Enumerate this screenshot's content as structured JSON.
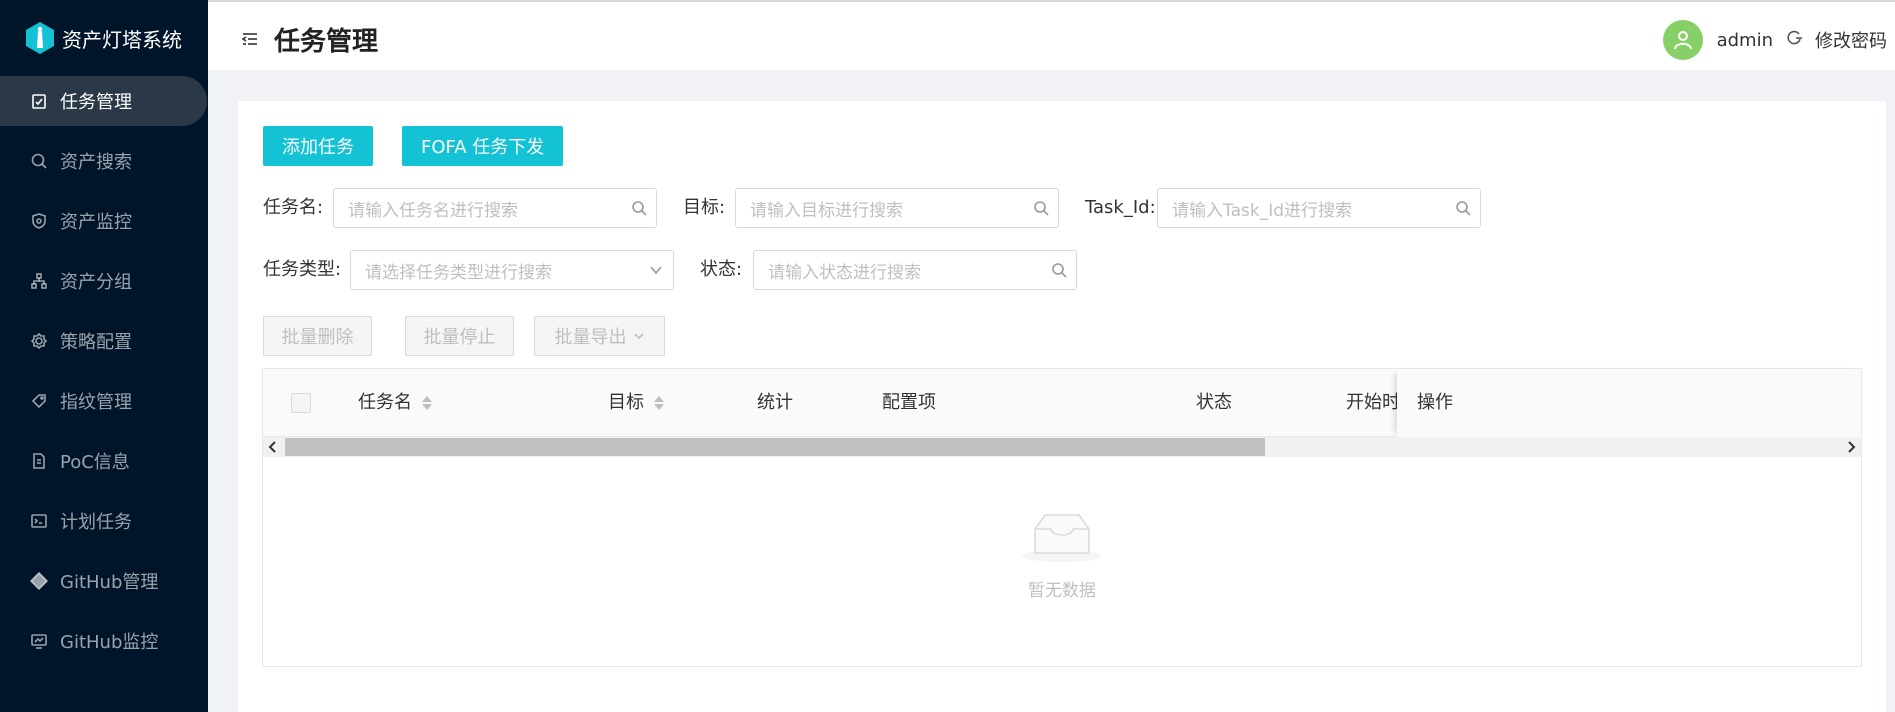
{
  "app": {
    "name": "资产灯塔系统"
  },
  "sidebar": {
    "items": [
      {
        "label": "任务管理",
        "icon": "clipboard-icon",
        "active": true
      },
      {
        "label": "资产搜索",
        "icon": "search-icon",
        "active": false
      },
      {
        "label": "资产监控",
        "icon": "shield-icon",
        "active": false
      },
      {
        "label": "资产分组",
        "icon": "cluster-icon",
        "active": false
      },
      {
        "label": "策略配置",
        "icon": "settings-icon",
        "active": false
      },
      {
        "label": "指纹管理",
        "icon": "tag-icon",
        "active": false
      },
      {
        "label": "PoC信息",
        "icon": "file-icon",
        "active": false
      },
      {
        "label": "计划任务",
        "icon": "terminal-icon",
        "active": false
      },
      {
        "label": "GitHub管理",
        "icon": "git-icon",
        "active": false
      },
      {
        "label": "GitHub监控",
        "icon": "monitor-icon",
        "active": false
      }
    ]
  },
  "header": {
    "title": "任务管理",
    "username": "admin",
    "change_password": "修改密码"
  },
  "toolbar": {
    "add_task": "添加任务",
    "fofa_task": "FOFA 任务下发"
  },
  "filters": {
    "task_name": {
      "label": "任务名:",
      "placeholder": "请输入任务名进行搜索"
    },
    "target": {
      "label": "目标:",
      "placeholder": "请输入目标进行搜索"
    },
    "task_id": {
      "label": "Task_Id:",
      "placeholder": "请输入Task_Id进行搜索"
    },
    "task_type": {
      "label": "任务类型:",
      "placeholder": "请选择任务类型进行搜索"
    },
    "status": {
      "label": "状态:",
      "placeholder": "请输入状态进行搜索"
    }
  },
  "batch": {
    "delete": "批量删除",
    "stop": "批量停止",
    "export": "批量导出"
  },
  "table": {
    "columns": {
      "name": "任务名",
      "target": "目标",
      "stats": "统计",
      "config": "配置项",
      "status": "状态",
      "start_time": "开始时",
      "actions": "操作"
    },
    "empty_text": "暂无数据"
  },
  "colors": {
    "sidebar_bg": "#001529",
    "primary": "#13c2d4",
    "avatar": "#87d068"
  }
}
